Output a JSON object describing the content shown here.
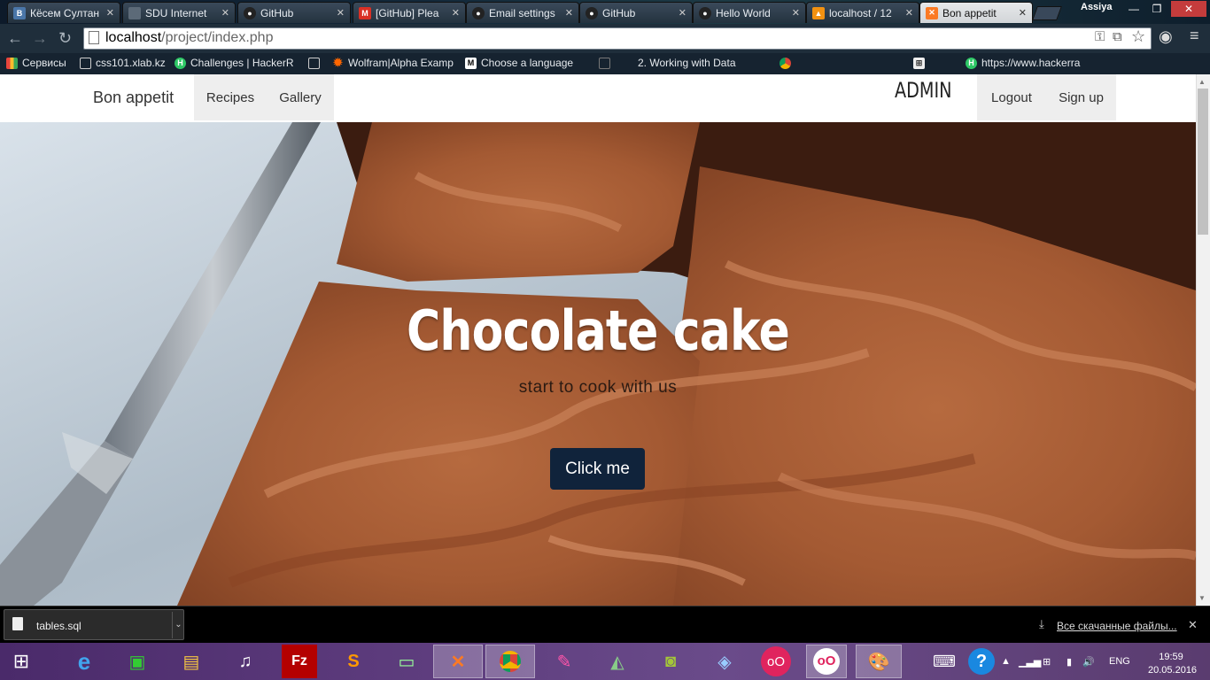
{
  "browser": {
    "tabs": [
      {
        "label": "Кёсем Султан",
        "icon": "vk-icon",
        "icon_color": "#4a76a8",
        "icon_text": "B"
      },
      {
        "label": "SDU Internet",
        "icon": "page-icon",
        "icon_color": "#888888",
        "icon_text": ""
      },
      {
        "label": "GitHub",
        "icon": "github-icon",
        "icon_color": "#222222",
        "icon_text": ""
      },
      {
        "label": "[GitHub] Plea",
        "icon": "gmail-icon",
        "icon_color": "#d93025",
        "icon_text": "M"
      },
      {
        "label": "Email settings",
        "icon": "github-icon",
        "icon_color": "#222222",
        "icon_text": ""
      },
      {
        "label": "GitHub",
        "icon": "github-icon",
        "icon_color": "#222222",
        "icon_text": ""
      },
      {
        "label": "Hello World",
        "icon": "github-icon",
        "icon_color": "#222222",
        "icon_text": ""
      },
      {
        "label": "localhost / 12",
        "icon": "phpmyadmin-icon",
        "icon_color": "#f29111",
        "icon_text": "▲"
      },
      {
        "label": "Bon appetit",
        "icon": "xampp-icon",
        "icon_color": "#fb7a24",
        "icon_text": "✕"
      }
    ],
    "profile_name": "Assiya",
    "url_host": "localhost",
    "url_path": "/project/index.php",
    "bookmarks": [
      {
        "label": "Сервисы",
        "icon": "apps-icon",
        "icon_color": "#e8453c"
      },
      {
        "label": "css101.xlab.kz",
        "icon": "page-icon",
        "icon_color": "#555555"
      },
      {
        "label": "Challenges | HackerR",
        "icon": "hackerrank-icon",
        "icon_color": "#2ec866"
      },
      {
        "label": "",
        "icon": "page-icon",
        "icon_color": "#555555"
      },
      {
        "label": "Wolfram|Alpha Examp",
        "icon": "wolfram-icon",
        "icon_color": "#dd1100"
      },
      {
        "label": "Choose a language",
        "icon": "codecademy-icon",
        "icon_color": "#ffffff"
      },
      {
        "label": "2. Working with Data",
        "icon": "page-icon",
        "icon_color": "#555555"
      },
      {
        "label": "",
        "icon": "chrome-icon",
        "icon_color": "#4285f4"
      },
      {
        "label": "",
        "icon": "grid-icon",
        "icon_color": "#dddddd"
      },
      {
        "label": "https://www.hackerra",
        "icon": "hackerrank-icon",
        "icon_color": "#2ec866"
      }
    ]
  },
  "site": {
    "brand": "Bon appetit",
    "nav": [
      "Recipes",
      "Gallery"
    ],
    "admin_label": "ADMIN",
    "right_nav": [
      "Logout",
      "Sign up"
    ],
    "hero_title": "Chocolate cake",
    "hero_subtitle": "start to cook with us",
    "cta_label": "Click me"
  },
  "downloads": {
    "file_name": "tables.sql",
    "show_all": "Все скачанные файлы..."
  },
  "taskbar": {
    "language": "ENG",
    "time": "19:59",
    "date": "20.05.2016"
  },
  "colors": {
    "cta_bg": "#10233b",
    "nav_active_bg": "#eeeeee"
  }
}
